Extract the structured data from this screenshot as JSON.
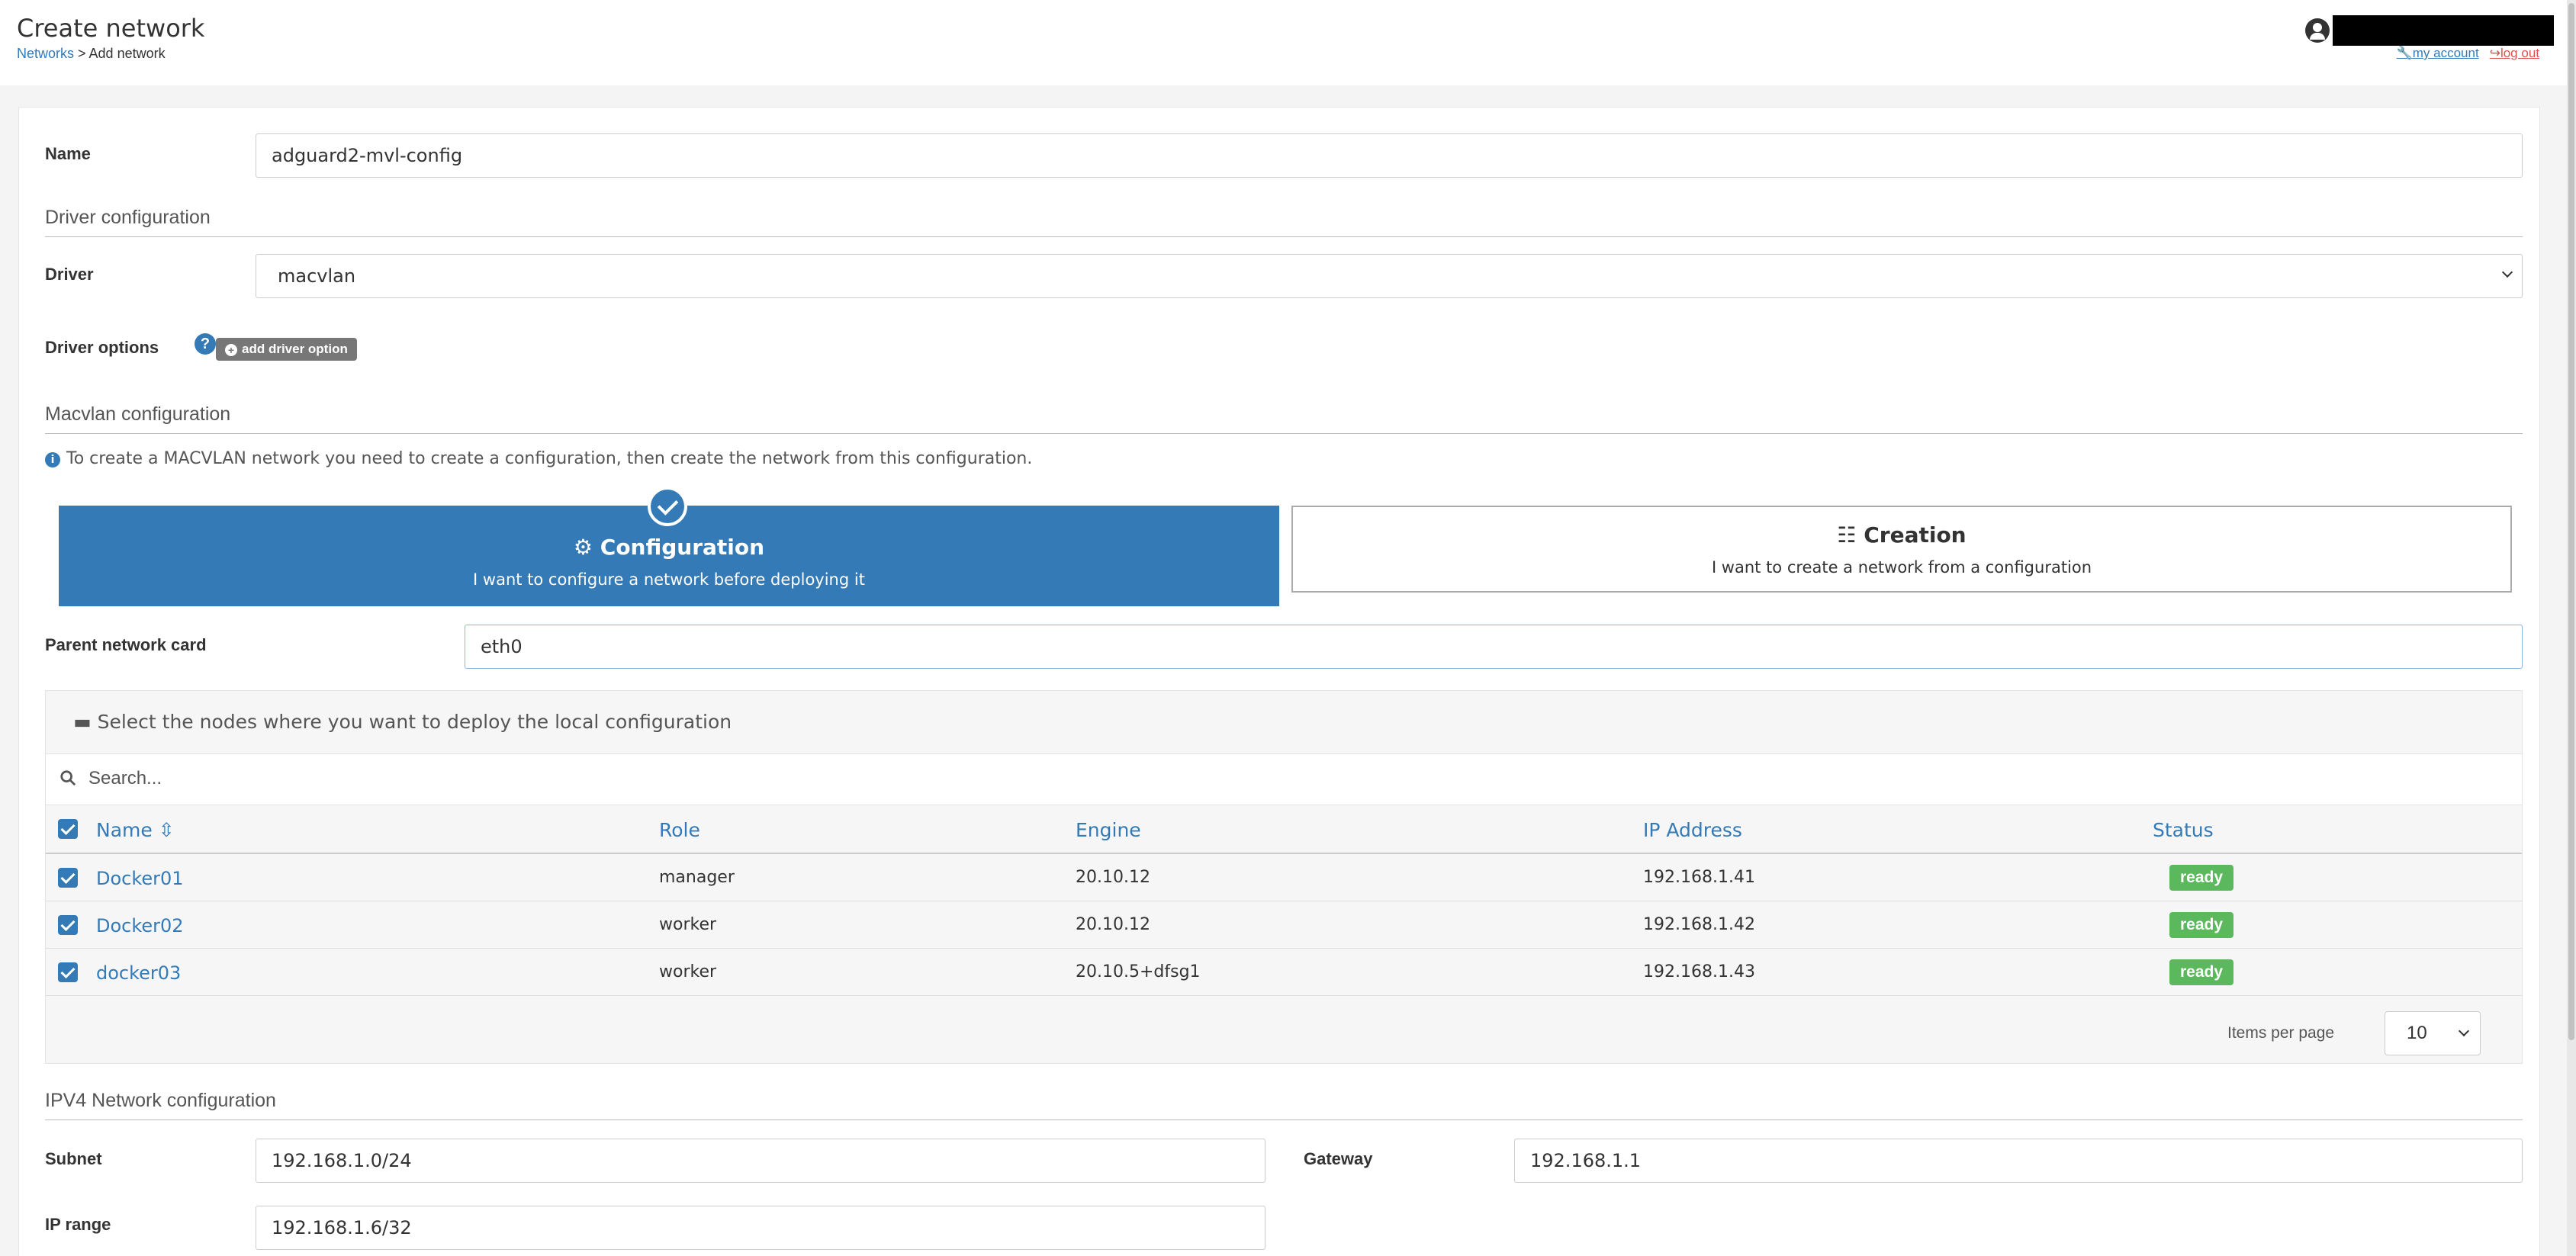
{
  "header": {
    "title": "Create network",
    "breadcrumb_link": "Networks",
    "breadcrumb_rest": " > Add network",
    "my_account": "my account",
    "logout": "log out"
  },
  "form": {
    "name_label": "Name",
    "name_value": "adguard2-mvl-config",
    "driver_section": "Driver configuration",
    "driver_label": "Driver",
    "driver_value": "macvlan",
    "driver_options_label": "Driver options",
    "add_driver_option": "add driver option",
    "macvlan_section": "Macvlan configuration",
    "macvlan_info": "To create a MACVLAN network you need to create a configuration, then create the network from this configuration.",
    "config_title": "Configuration",
    "config_sub": "I want to configure a network before deploying it",
    "creation_title": "Creation",
    "creation_sub": "I want to create a network from a configuration",
    "parent_label": "Parent network card",
    "parent_value": "eth0"
  },
  "nodes": {
    "title": "Select the nodes where you want to deploy the local configuration",
    "search_placeholder": "Search...",
    "columns": [
      "Name",
      "Role",
      "Engine",
      "IP Address",
      "Status"
    ],
    "rows": [
      {
        "name": "Docker01",
        "role": "manager",
        "engine": "20.10.12",
        "ip": "192.168.1.41",
        "status": "ready"
      },
      {
        "name": "Docker02",
        "role": "worker",
        "engine": "20.10.12",
        "ip": "192.168.1.42",
        "status": "ready"
      },
      {
        "name": "docker03",
        "role": "worker",
        "engine": "20.10.5+dfsg1",
        "ip": "192.168.1.43",
        "status": "ready"
      }
    ],
    "items_per_page_label": "Items per page",
    "items_per_page_value": "10"
  },
  "ipv4": {
    "section": "IPV4 Network configuration",
    "subnet_label": "Subnet",
    "subnet_value": "192.168.1.0/24",
    "gateway_label": "Gateway",
    "gateway_value": "192.168.1.1",
    "range_label": "IP range",
    "range_value": "192.168.1.6/32"
  },
  "colors": {
    "accent": "#337ab7",
    "status_ready": "#5cb85c",
    "logout": "#d9534f"
  },
  "icons": [
    "user-circle-icon",
    "wrench-icon",
    "logout-icon",
    "question-icon",
    "plus-circle-icon",
    "info-icon",
    "check-circle-icon",
    "cog-icon",
    "sitemap-icon",
    "server-icon",
    "search-icon",
    "sort-icon",
    "checkbox-icon",
    "chevron-down-icon"
  ]
}
